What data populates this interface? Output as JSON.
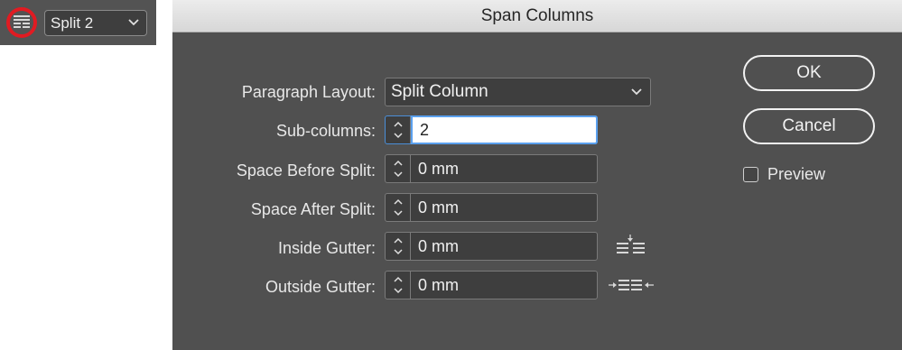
{
  "toolbar": {
    "span_icon": "span-columns-icon",
    "select_value": "Split 2",
    "highlight_color": "#e11b22"
  },
  "dialog": {
    "title": "Span Columns",
    "fields": {
      "paragraph_layout": {
        "label": "Paragraph Layout:",
        "value": "Split Column"
      },
      "sub_columns": {
        "label": "Sub-columns:",
        "value": "2"
      },
      "space_before": {
        "label": "Space Before Split:",
        "value": "0 mm"
      },
      "space_after": {
        "label": "Space After Split:",
        "value": "0 mm"
      },
      "inside_gutter": {
        "label": "Inside Gutter:",
        "value": "0 mm",
        "icon": "inside-gutter-icon"
      },
      "outside_gutter": {
        "label": "Outside Gutter:",
        "value": "0 mm",
        "icon": "outside-gutter-icon"
      }
    },
    "buttons": {
      "ok": "OK",
      "cancel": "Cancel"
    },
    "preview": {
      "label": "Preview",
      "checked": false
    }
  }
}
